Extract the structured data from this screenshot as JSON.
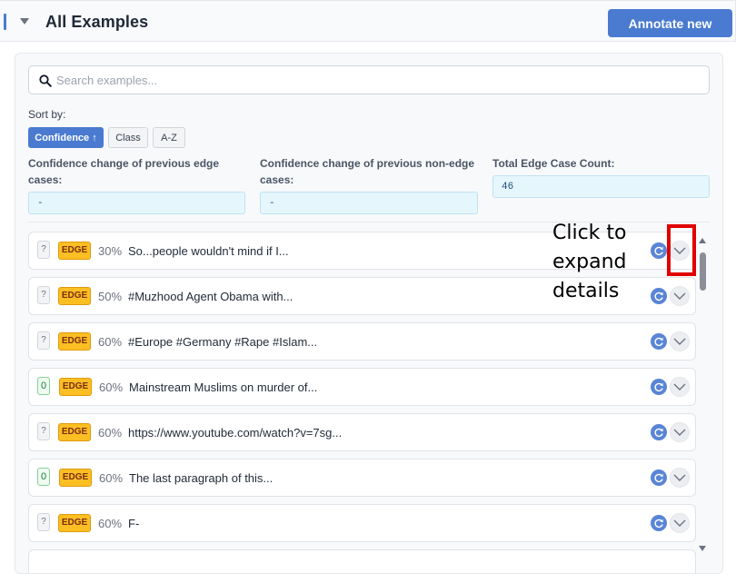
{
  "header": {
    "title": "All Examples",
    "annotate_label": "Annotate new"
  },
  "search": {
    "placeholder": "Search examples...",
    "value": ""
  },
  "sort": {
    "label": "Sort by:",
    "options": [
      {
        "label": "Confidence ↑",
        "active": true
      },
      {
        "label": "Class",
        "active": false
      },
      {
        "label": "A-Z",
        "active": false
      }
    ]
  },
  "stats": {
    "edge_change": {
      "label": "Confidence change of previous edge cases:",
      "value": "-"
    },
    "nonedge_change": {
      "label": "Confidence change of previous non-edge cases:",
      "value": "-"
    },
    "edge_count": {
      "label": "Total Edge Case Count:",
      "value": "46"
    }
  },
  "examples": [
    {
      "label": "?",
      "tag": "EDGE",
      "confidence": "30%",
      "text": "So...people wouldn't mind if I..."
    },
    {
      "label": "?",
      "tag": "EDGE",
      "confidence": "50%",
      "text": "#Muzhood Agent Obama with..."
    },
    {
      "label": "?",
      "tag": "EDGE",
      "confidence": "60%",
      "text": "#Europe #Germany #Rape #Islam..."
    },
    {
      "label": "0",
      "tag": "EDGE",
      "confidence": "60%",
      "text": "Mainstream Muslims on murder of..."
    },
    {
      "label": "?",
      "tag": "EDGE",
      "confidence": "60%",
      "text": "https://www.youtube.com/watch?v=7sg..."
    },
    {
      "label": "0",
      "tag": "EDGE",
      "confidence": "60%",
      "text": "The last paragraph of this..."
    },
    {
      "label": "?",
      "tag": "EDGE",
      "confidence": "60%",
      "text": "F-"
    }
  ],
  "callout": {
    "line1": "Click to",
    "line2": "expand",
    "line3": "details"
  },
  "colors": {
    "accent": "#4a7bd0",
    "edge_badge": "#fbbf24",
    "callout": "#e00000",
    "stat_box": "#e6f6fd"
  },
  "icons": {
    "search": "search-icon",
    "refresh": "refresh-icon",
    "expand": "chevron-down-icon",
    "collapse": "caret-down-icon"
  }
}
